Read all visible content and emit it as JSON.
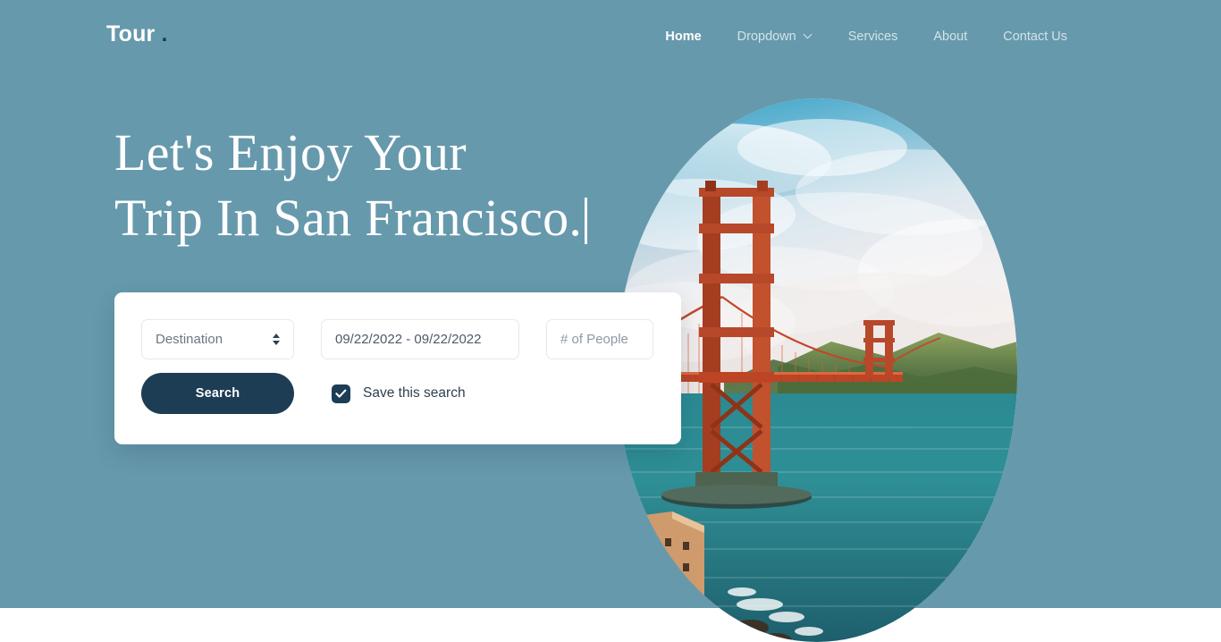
{
  "brand": {
    "name": "Tour",
    "dot": "."
  },
  "nav": {
    "items": [
      {
        "label": "Home",
        "active": true,
        "has_caret": false,
        "icon": ""
      },
      {
        "label": "Dropdown",
        "active": false,
        "has_caret": true,
        "icon": "chevron-down-icon"
      },
      {
        "label": "Services",
        "active": false,
        "has_caret": false,
        "icon": ""
      },
      {
        "label": "About",
        "active": false,
        "has_caret": false,
        "icon": ""
      },
      {
        "label": "Contact Us",
        "active": false,
        "has_caret": false,
        "icon": ""
      }
    ]
  },
  "hero": {
    "headline_line1": "Let's Enjoy Your",
    "headline_line2": "Trip In San Francisco.",
    "typing_caret": true,
    "underline_word": "San Francisco.",
    "photo_alt": "Golden Gate Bridge over San Francisco Bay"
  },
  "search": {
    "destination": {
      "selected": "Destination",
      "options": [
        "Destination"
      ],
      "icon": "stepper-updown-icon"
    },
    "dates": {
      "value": "09/22/2022 - 09/22/2022",
      "placeholder": "09/22/2022 - 09/22/2022"
    },
    "people": {
      "value": "",
      "placeholder": "# of People"
    },
    "search_button": "Search",
    "save_checkbox": {
      "label": "Save this search",
      "checked": true,
      "icon": "check-icon"
    }
  },
  "colors": {
    "hero_background": "#6699ac",
    "navy": "#1d3d55",
    "card_background": "#ffffff",
    "underline": "#adc9d6",
    "page_background": "#ffffff",
    "field_border": "#e6e9ed"
  }
}
